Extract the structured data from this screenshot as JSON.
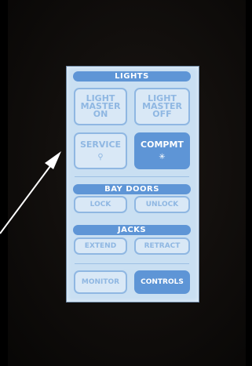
{
  "lights": {
    "header": "LIGHTS",
    "master_on": [
      "LIGHT",
      "MASTER",
      "ON"
    ],
    "master_off": [
      "LIGHT",
      "MASTER",
      "OFF"
    ],
    "service": "SERVICE",
    "compmt": "COMPMT"
  },
  "bay_doors": {
    "header": "BAY DOORS",
    "lock": "LOCK",
    "unlock": "UNLOCK"
  },
  "jacks": {
    "header": "JACKS",
    "extend": "EXTEND",
    "retract": "RETRACT"
  },
  "nav": {
    "monitor": "MONITOR",
    "controls": "CONTROLS"
  },
  "icons": {
    "service": "lightbulb-icon",
    "compmt": "lightbulb-on-icon"
  },
  "colors": {
    "accent": "#5e95d6",
    "screen_bg": "#c9dff2",
    "inactive_text": "#8fb7e2"
  }
}
